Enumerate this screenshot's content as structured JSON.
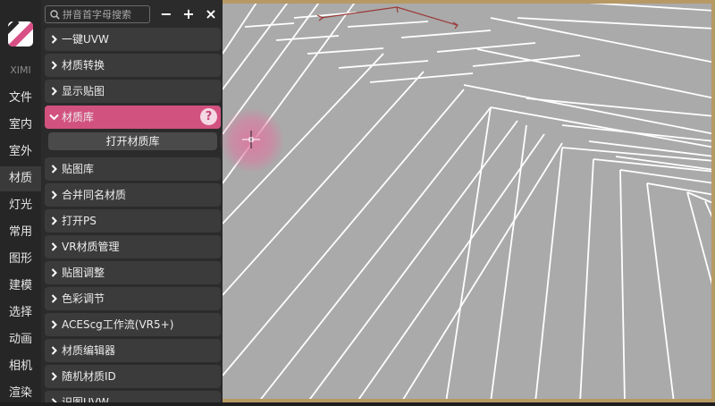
{
  "sidebar": {
    "brand": "XIMI",
    "items": [
      "文件",
      "室内",
      "室外",
      "材质",
      "灯光",
      "常用",
      "图形",
      "建模",
      "选择",
      "动画",
      "相机",
      "渲染"
    ],
    "active": "材质"
  },
  "panel": {
    "search_placeholder": "拼音首字母搜索",
    "window_buttons": {
      "minimize": "−",
      "add": "+",
      "close": "×"
    },
    "items": [
      "一键UVW",
      "材质转换",
      "显示贴图",
      "材质库",
      "贴图库",
      "合并同名材质",
      "打开PS",
      "VR材质管理",
      "贴图调整",
      "色彩调节",
      "ACEScg工作流(VR5+)",
      "材质编辑器",
      "随机材质ID",
      "识图UVW"
    ],
    "active_item": "材质库",
    "help_symbol": "?",
    "open_library_button": "打开材质库"
  },
  "colors": {
    "accent": "#d2527f",
    "panel_bg": "#2b2b2b",
    "item_bg": "#3b3b3b",
    "viewport_bg": "#aaaaaa",
    "viewport_frame": "#b79a63"
  },
  "icons": {
    "search": "search-icon",
    "chevron": "chevron-right-icon",
    "help": "help-icon",
    "cursor": "crosshair-icon",
    "viewcube": "viewcube-icon"
  }
}
